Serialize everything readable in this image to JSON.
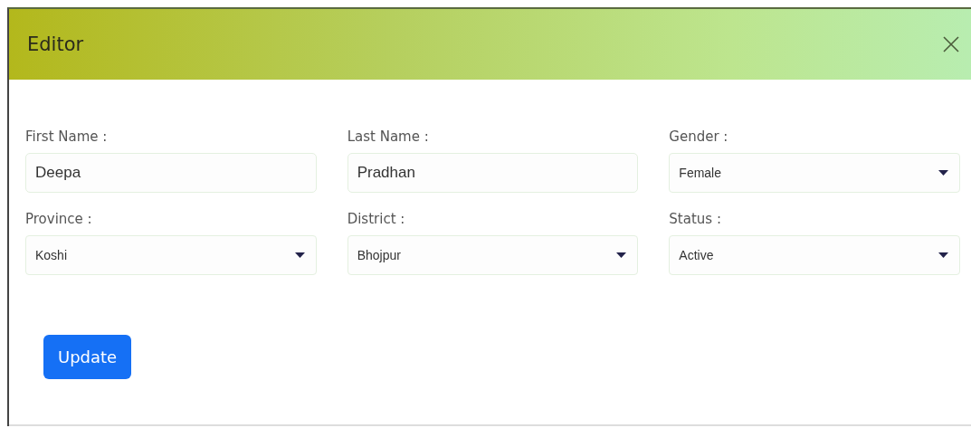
{
  "window": {
    "title": "Editor"
  },
  "fields": [
    {
      "label": "First Name :",
      "kind": "text",
      "value": "Deepa"
    },
    {
      "label": "Last Name :",
      "kind": "text",
      "value": "Pradhan"
    },
    {
      "label": "Gender :",
      "kind": "select",
      "value": "Female"
    },
    {
      "label": "Province :",
      "kind": "select",
      "value": "Koshi"
    },
    {
      "label": "District :",
      "kind": "select",
      "value": "Bhojpur"
    },
    {
      "label": "Status :",
      "kind": "select",
      "value": "Active"
    }
  ],
  "buttons": [
    "Update"
  ]
}
